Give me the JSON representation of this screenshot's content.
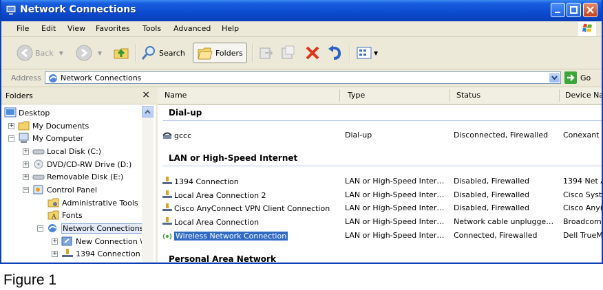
{
  "window": {
    "title": "Network Connections",
    "icon": "network-connections-icon"
  },
  "menu": [
    "File",
    "Edit",
    "View",
    "Favorites",
    "Tools",
    "Advanced",
    "Help"
  ],
  "toolbar": {
    "back_label": "Back",
    "search_label": "Search",
    "folders_label": "Folders"
  },
  "address": {
    "label": "Address",
    "value": "Network Connections",
    "go_label": "Go"
  },
  "folders_pane": {
    "title": "Folders",
    "close": "×",
    "tree": [
      {
        "label": "Desktop",
        "icon": "desktop-icon"
      },
      {
        "label": "My Documents",
        "icon": "folder-icon",
        "expander": "+"
      },
      {
        "label": "My Computer",
        "icon": "computer-icon",
        "expander": "−"
      },
      {
        "label": "Local Disk (C:)",
        "icon": "disk-icon",
        "expander": "+"
      },
      {
        "label": "DVD/CD-RW Drive (D:)",
        "icon": "cd-icon",
        "expander": "+"
      },
      {
        "label": "Removable Disk (E:)",
        "icon": "disk-icon",
        "expander": "+"
      },
      {
        "label": "Control Panel",
        "icon": "control-panel-icon",
        "expander": "−"
      },
      {
        "label": "Administrative Tools",
        "icon": "admin-tools-icon"
      },
      {
        "label": "Fonts",
        "icon": "fonts-folder-icon"
      },
      {
        "label": "Network Connections",
        "icon": "network-icon",
        "expander": "−"
      },
      {
        "label": "New Connection \\",
        "icon": "new-connection-icon",
        "expander": "+"
      },
      {
        "label": "1394 Connection",
        "icon": "lan-icon",
        "expander": "+"
      }
    ]
  },
  "columns": [
    "Name",
    "Type",
    "Status",
    "Device Na"
  ],
  "groups": [
    {
      "title": "Dial-up",
      "rows": [
        {
          "name": "gccc",
          "type": "Dial-up",
          "status": "Disconnected, Firewalled",
          "device": "Conexant",
          "icon": "dialup-icon"
        }
      ]
    },
    {
      "title": "LAN or High-Speed Internet",
      "rows": [
        {
          "name": "1394 Connection",
          "type": "LAN or High-Speed Inter…",
          "status": "Disabled, Firewalled",
          "device": "1394 Net A",
          "icon": "lan-icon"
        },
        {
          "name": "Local Area Connection 2",
          "type": "LAN or High-Speed Inter…",
          "status": "Disabled, Firewalled",
          "device": "Cisco Syst",
          "icon": "lan-icon"
        },
        {
          "name": "Cisco AnyConnect VPN Client Connection",
          "type": "LAN or High-Speed Inter…",
          "status": "Disabled, Firewalled",
          "device": "Cisco Any(",
          "icon": "lan-icon"
        },
        {
          "name": "Local Area Connection",
          "type": "LAN or High-Speed Inter…",
          "status": "Network cable unplugge…",
          "device": "Broadcom",
          "icon": "lan-icon"
        },
        {
          "name": "Wireless Network Connection",
          "type": "LAN or High-Speed Inter…",
          "status": "Connected, Firewalled",
          "device": "Dell TrueM",
          "icon": "wireless-icon",
          "selected": true
        }
      ]
    },
    {
      "title": "Personal Area Network",
      "rows": []
    }
  ],
  "caption": "Figure 1"
}
